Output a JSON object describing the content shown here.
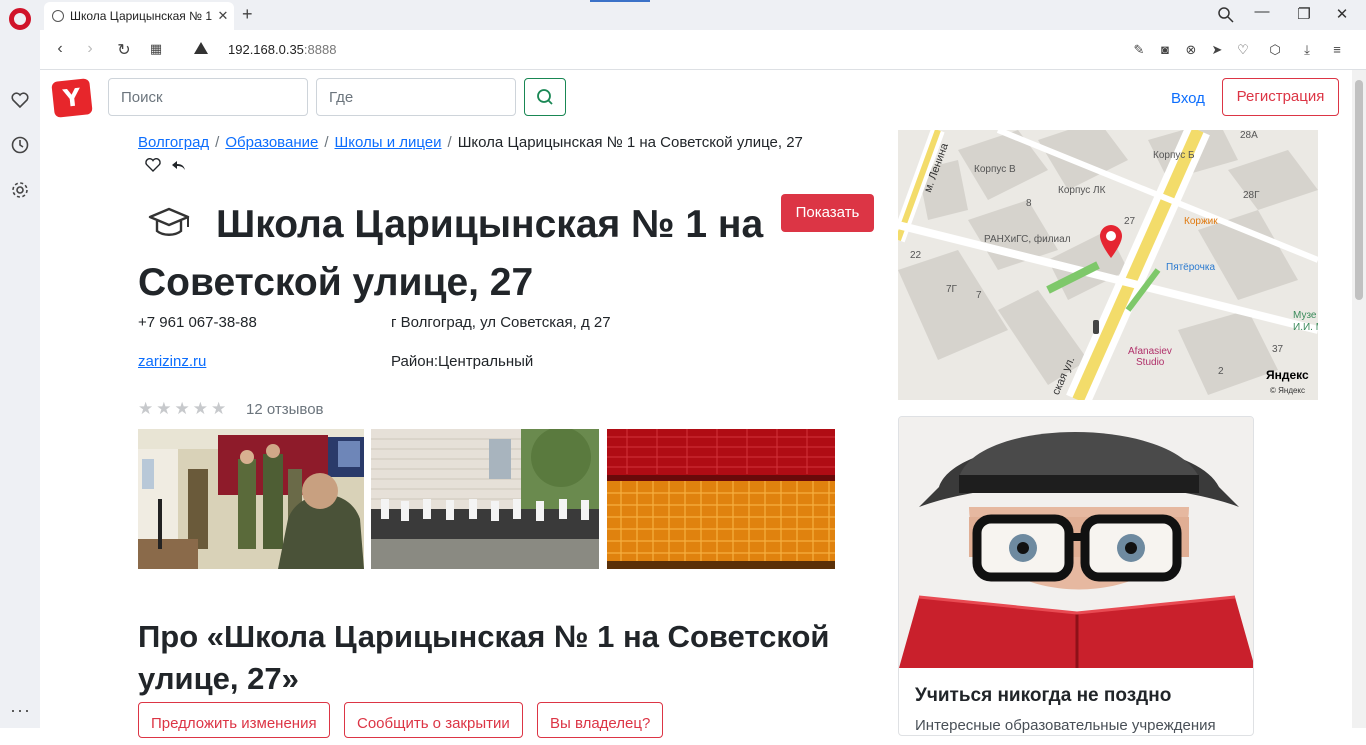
{
  "browser": {
    "tab_title": "Школа Царицынская № 1",
    "tab_favicon": "globe-icon",
    "url_host": "192.168.0.35",
    "url_port": ":8888",
    "security": "not-secure-warning-icon"
  },
  "header": {
    "logo_letter": "Y",
    "search_placeholder": "Поиск",
    "where_placeholder": "Где",
    "login_label": "Вход",
    "register_label": "Регистрация",
    "accent_color": "#dc3545"
  },
  "breadcrumb": {
    "items": [
      "Волгоград",
      "Образование",
      "Школы и лицеи"
    ],
    "current": "Школа Царицынская № 1 на Советской улице, 27"
  },
  "place": {
    "title": "Школа Царицынская № 1 на Советской улице, 27",
    "show_button": "Показать",
    "phone": "+7 961 067-38-88",
    "address": "г Волгоград, ул Советская, д 27",
    "website": "zarizinz.ru",
    "district": "Район:Центральный",
    "rating_stars": "★★★★★",
    "rating_value": 0,
    "reviews": "12 отзывов"
  },
  "about": {
    "title": "Про «Школа Царицынская № 1 на Советской улице, 27»",
    "buttons": [
      "Предложить изменения",
      "Сообщить о закрытии",
      "Вы владелец?"
    ]
  },
  "map": {
    "labels": {
      "korpus_v": "Корпус В",
      "korpus_b": "Корпус Б",
      "korpus_lk": "Корпус ЛК",
      "ranhigs": "РАНХиГС, филиал",
      "korzhik": "Коржик",
      "pyaterochka": "Пятёрочка",
      "afanasiev": "Afanasiev",
      "studio": "Studio",
      "lenina": "м. Ленина",
      "street": "ская ул.",
      "muzei": "Музе",
      "im": "И.И. М",
      "n28a": "28А",
      "n28g": "28Г",
      "n27": "27",
      "n22": "22",
      "n7g": "7Г",
      "n7": "7",
      "n8": "8",
      "n37": "37",
      "n2": "2"
    },
    "brand": "Яндекс",
    "copyright": "© Яндекс"
  },
  "card": {
    "title": "Учиться никогда не поздно",
    "text": "Интересные образовательные учреждения"
  }
}
